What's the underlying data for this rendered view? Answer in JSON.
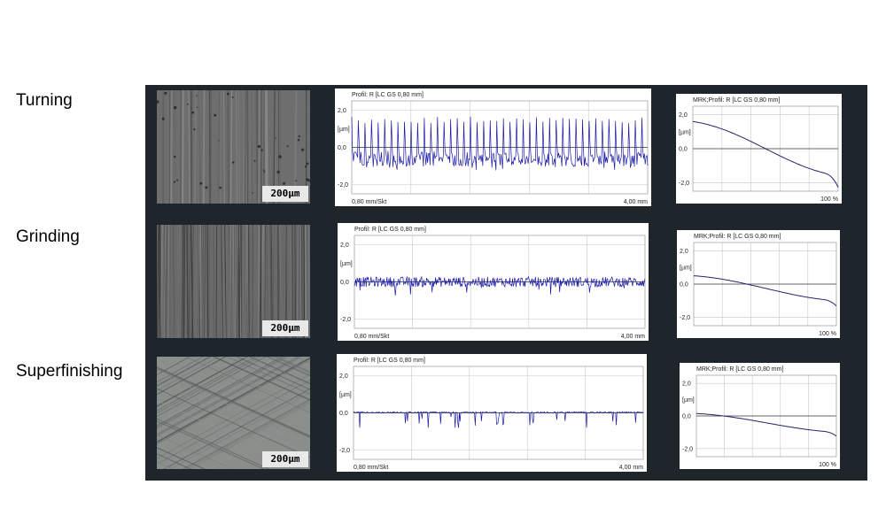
{
  "rows": [
    {
      "label": "Turning"
    },
    {
      "label": "Grinding"
    },
    {
      "label": "Superfinishing"
    }
  ],
  "micrograph": {
    "scale_label": "200µm"
  },
  "chart_data": [
    {
      "type": "line",
      "process": "Turning",
      "title": "Profil: R [LC GS 0,80 mm]",
      "ylabel": "[µm]",
      "ytick_labels": [
        "2,0",
        "0,0",
        "-2,0"
      ],
      "ylim": [
        -2.5,
        2.5
      ],
      "xlim": [
        0,
        4.0
      ],
      "x_left_label": "0,80 mm/Skt",
      "x_right_label": "4,00 mm",
      "series": [
        {
          "color": "#1a1aa8",
          "pattern": "periodic-peaks",
          "peak_count": 45,
          "peak_max": 1.6,
          "valley_min": -1.4,
          "mean": 0.1
        }
      ]
    },
    {
      "type": "line",
      "process": "Turning",
      "title": "MRK;Profil: R [LC GS 0,80 mm]",
      "ylabel": "[µm]",
      "ytick_labels": [
        "2,0",
        "0,0",
        "-2,0"
      ],
      "ylim": [
        -2.5,
        2.5
      ],
      "xlim": [
        0,
        100
      ],
      "x_right_label": "100 %",
      "series": [
        {
          "color": "#22226e",
          "pattern": "material-ratio-curve",
          "start": 1.6,
          "end": -1.6
        }
      ]
    },
    {
      "type": "line",
      "process": "Grinding",
      "title": "Profil: R [LC GS 0,80 mm]",
      "ylabel": "[µm]",
      "ytick_labels": [
        "2,0",
        "0,0",
        "-2,0"
      ],
      "ylim": [
        -2.5,
        2.5
      ],
      "xlim": [
        0,
        4.0
      ],
      "x_left_label": "0,80 mm/Skt",
      "x_right_label": "4,00 mm",
      "series": [
        {
          "color": "#1a1aa8",
          "pattern": "random-noise",
          "peak_max": 0.45,
          "valley_min": -0.75,
          "mean": 0.0
        }
      ]
    },
    {
      "type": "line",
      "process": "Grinding",
      "title": "MRK;Profil: R [LC GS 0,80 mm]",
      "ylabel": "[µm]",
      "ytick_labels": [
        "2,0",
        "0,0",
        "-2,0"
      ],
      "ylim": [
        -2.5,
        2.5
      ],
      "xlim": [
        0,
        100
      ],
      "x_right_label": "100 %",
      "series": [
        {
          "color": "#22226e",
          "pattern": "material-ratio-curve",
          "start": 0.5,
          "end": -1.0
        }
      ]
    },
    {
      "type": "line",
      "process": "Superfinishing",
      "title": "Profil: R [LC GS 0,80 mm]",
      "ylabel": "[µm]",
      "ytick_labels": [
        "2,0",
        "0,0",
        "-2,0"
      ],
      "ylim": [
        -2.5,
        2.5
      ],
      "xlim": [
        0,
        4.0
      ],
      "x_left_label": "0,80 mm/Skt",
      "x_right_label": "4,00 mm",
      "series": [
        {
          "color": "#1a1aa8",
          "pattern": "plateau-with-valleys",
          "peak_max": 0.1,
          "valley_min": -0.9,
          "mean": 0.0
        }
      ]
    },
    {
      "type": "line",
      "process": "Superfinishing",
      "title": "MRK;Profil: R [LC GS 0,80 mm]",
      "ylabel": "[µm]",
      "ytick_labels": [
        "2,0",
        "0,0",
        "-2,0"
      ],
      "ylim": [
        -2.5,
        2.5
      ],
      "xlim": [
        0,
        100
      ],
      "x_right_label": "100 %",
      "series": [
        {
          "color": "#22226e",
          "pattern": "material-ratio-curve",
          "start": 0.15,
          "end": -1.0
        }
      ]
    }
  ]
}
